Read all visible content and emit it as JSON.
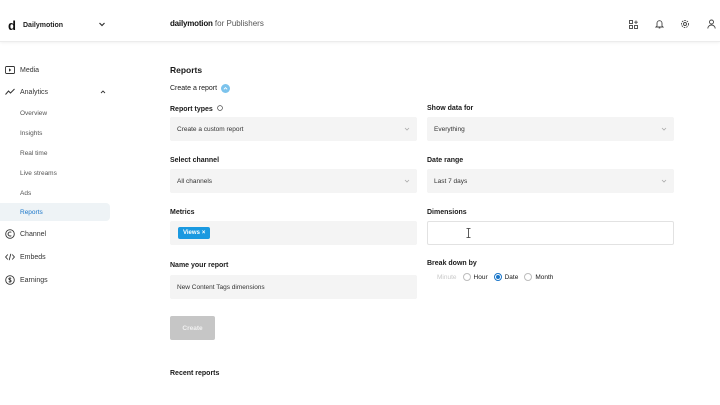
{
  "topbar": {
    "logo_letter": "d",
    "org_name": "Dailymotion",
    "brand_main": "dailymotion",
    "brand_sub": " for Publishers"
  },
  "sidebar": {
    "items": [
      {
        "label": "Media",
        "icon": "media-icon"
      },
      {
        "label": "Analytics",
        "icon": "analytics-icon"
      },
      {
        "label": "Channel",
        "icon": "channel-icon"
      },
      {
        "label": "Embeds",
        "icon": "embeds-icon"
      },
      {
        "label": "Earnings",
        "icon": "earnings-icon"
      }
    ],
    "sub_items": [
      {
        "label": "Overview"
      },
      {
        "label": "Insights"
      },
      {
        "label": "Real time"
      },
      {
        "label": "Live streams"
      },
      {
        "label": "Ads"
      },
      {
        "label": "Reports"
      }
    ]
  },
  "main": {
    "page_title": "Reports",
    "subtitle": "Create a report",
    "report_types": {
      "label": "Report types",
      "value": "Create a custom report"
    },
    "show_data_for": {
      "label": "Show data for",
      "value": "Everything"
    },
    "select_channel": {
      "label": "Select channel",
      "value": "All channels"
    },
    "date_range": {
      "label": "Date range",
      "value": "Last 7 days"
    },
    "metrics": {
      "label": "Metrics",
      "chip": "Views",
      "chip_close": "×"
    },
    "dimensions": {
      "label": "Dimensions",
      "value": ""
    },
    "name_report": {
      "label": "Name your report",
      "value": "New Content Tags dimensions"
    },
    "break_down": {
      "label": "Break down by",
      "options": [
        {
          "label": "Minute"
        },
        {
          "label": "Hour"
        },
        {
          "label": "Date"
        },
        {
          "label": "Month"
        }
      ],
      "selected": "Date"
    },
    "create_button": "Create",
    "recent_reports": "Recent reports"
  },
  "colors": {
    "accent": "#1a76c9",
    "chip_bg": "#1a99e0",
    "active_bg": "#eef3f6",
    "field_bg": "#f4f4f4",
    "button_disabled": "#c6c6c6"
  }
}
